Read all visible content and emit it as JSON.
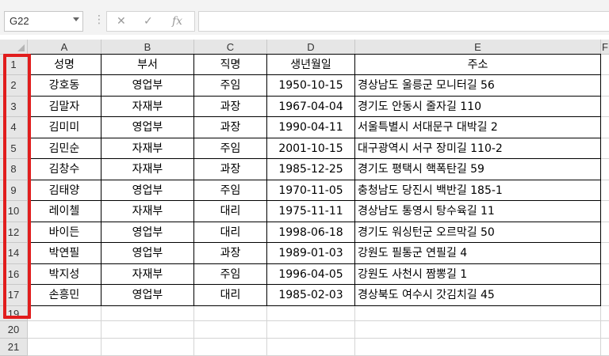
{
  "namebox": {
    "value": "G22"
  },
  "formula_bar": {
    "cancel_icon": "✕",
    "enter_icon": "✓",
    "fx_label": "fx",
    "value": ""
  },
  "columns": [
    "A",
    "B",
    "C",
    "D",
    "E",
    "F"
  ],
  "rows": [
    "1",
    "2",
    "3",
    "4",
    "5",
    "8",
    "9",
    "10",
    "12",
    "14",
    "16",
    "17",
    "19",
    "20",
    "21"
  ],
  "table": {
    "headers": [
      "성명",
      "부서",
      "직명",
      "생년월일",
      "주소"
    ],
    "records": [
      [
        "강호동",
        "영업부",
        "주임",
        "1950-10-15",
        "경상남도 울릉군 모니터길 56"
      ],
      [
        "김말자",
        "자재부",
        "과장",
        "1967-04-04",
        "경기도 안동시 줄자길 110"
      ],
      [
        "김미미",
        "영업부",
        "과장",
        "1990-04-11",
        "서울특별시 서대문구 대박길 2"
      ],
      [
        "김민순",
        "자재부",
        "주임",
        "2001-10-15",
        "대구광역시 서구 장미길 110-2"
      ],
      [
        "김창수",
        "자재부",
        "과장",
        "1985-12-25",
        "경기도 평택시 핵폭탄길 59"
      ],
      [
        "김태양",
        "영업부",
        "주임",
        "1970-11-05",
        "충청남도 당진시 백반길 185-1"
      ],
      [
        "레이첼",
        "자재부",
        "대리",
        "1975-11-11",
        "경상남도 통영시 탕수육길 11"
      ],
      [
        "바이든",
        "영업부",
        "대리",
        "1998-06-18",
        "경기도 워싱턴군 오르막길 50"
      ],
      [
        "박연필",
        "영업부",
        "과장",
        "1989-01-03",
        "강원도 필통군 연필길 4"
      ],
      [
        "박지성",
        "자재부",
        "주임",
        "1996-04-05",
        "강원도 사천시 짬뽕길 1"
      ],
      [
        "손흥민",
        "영업부",
        "대리",
        "1985-02-03",
        "경상북도 여수시 갓김치길 45"
      ]
    ]
  },
  "highlight_color": "#e11d1d"
}
